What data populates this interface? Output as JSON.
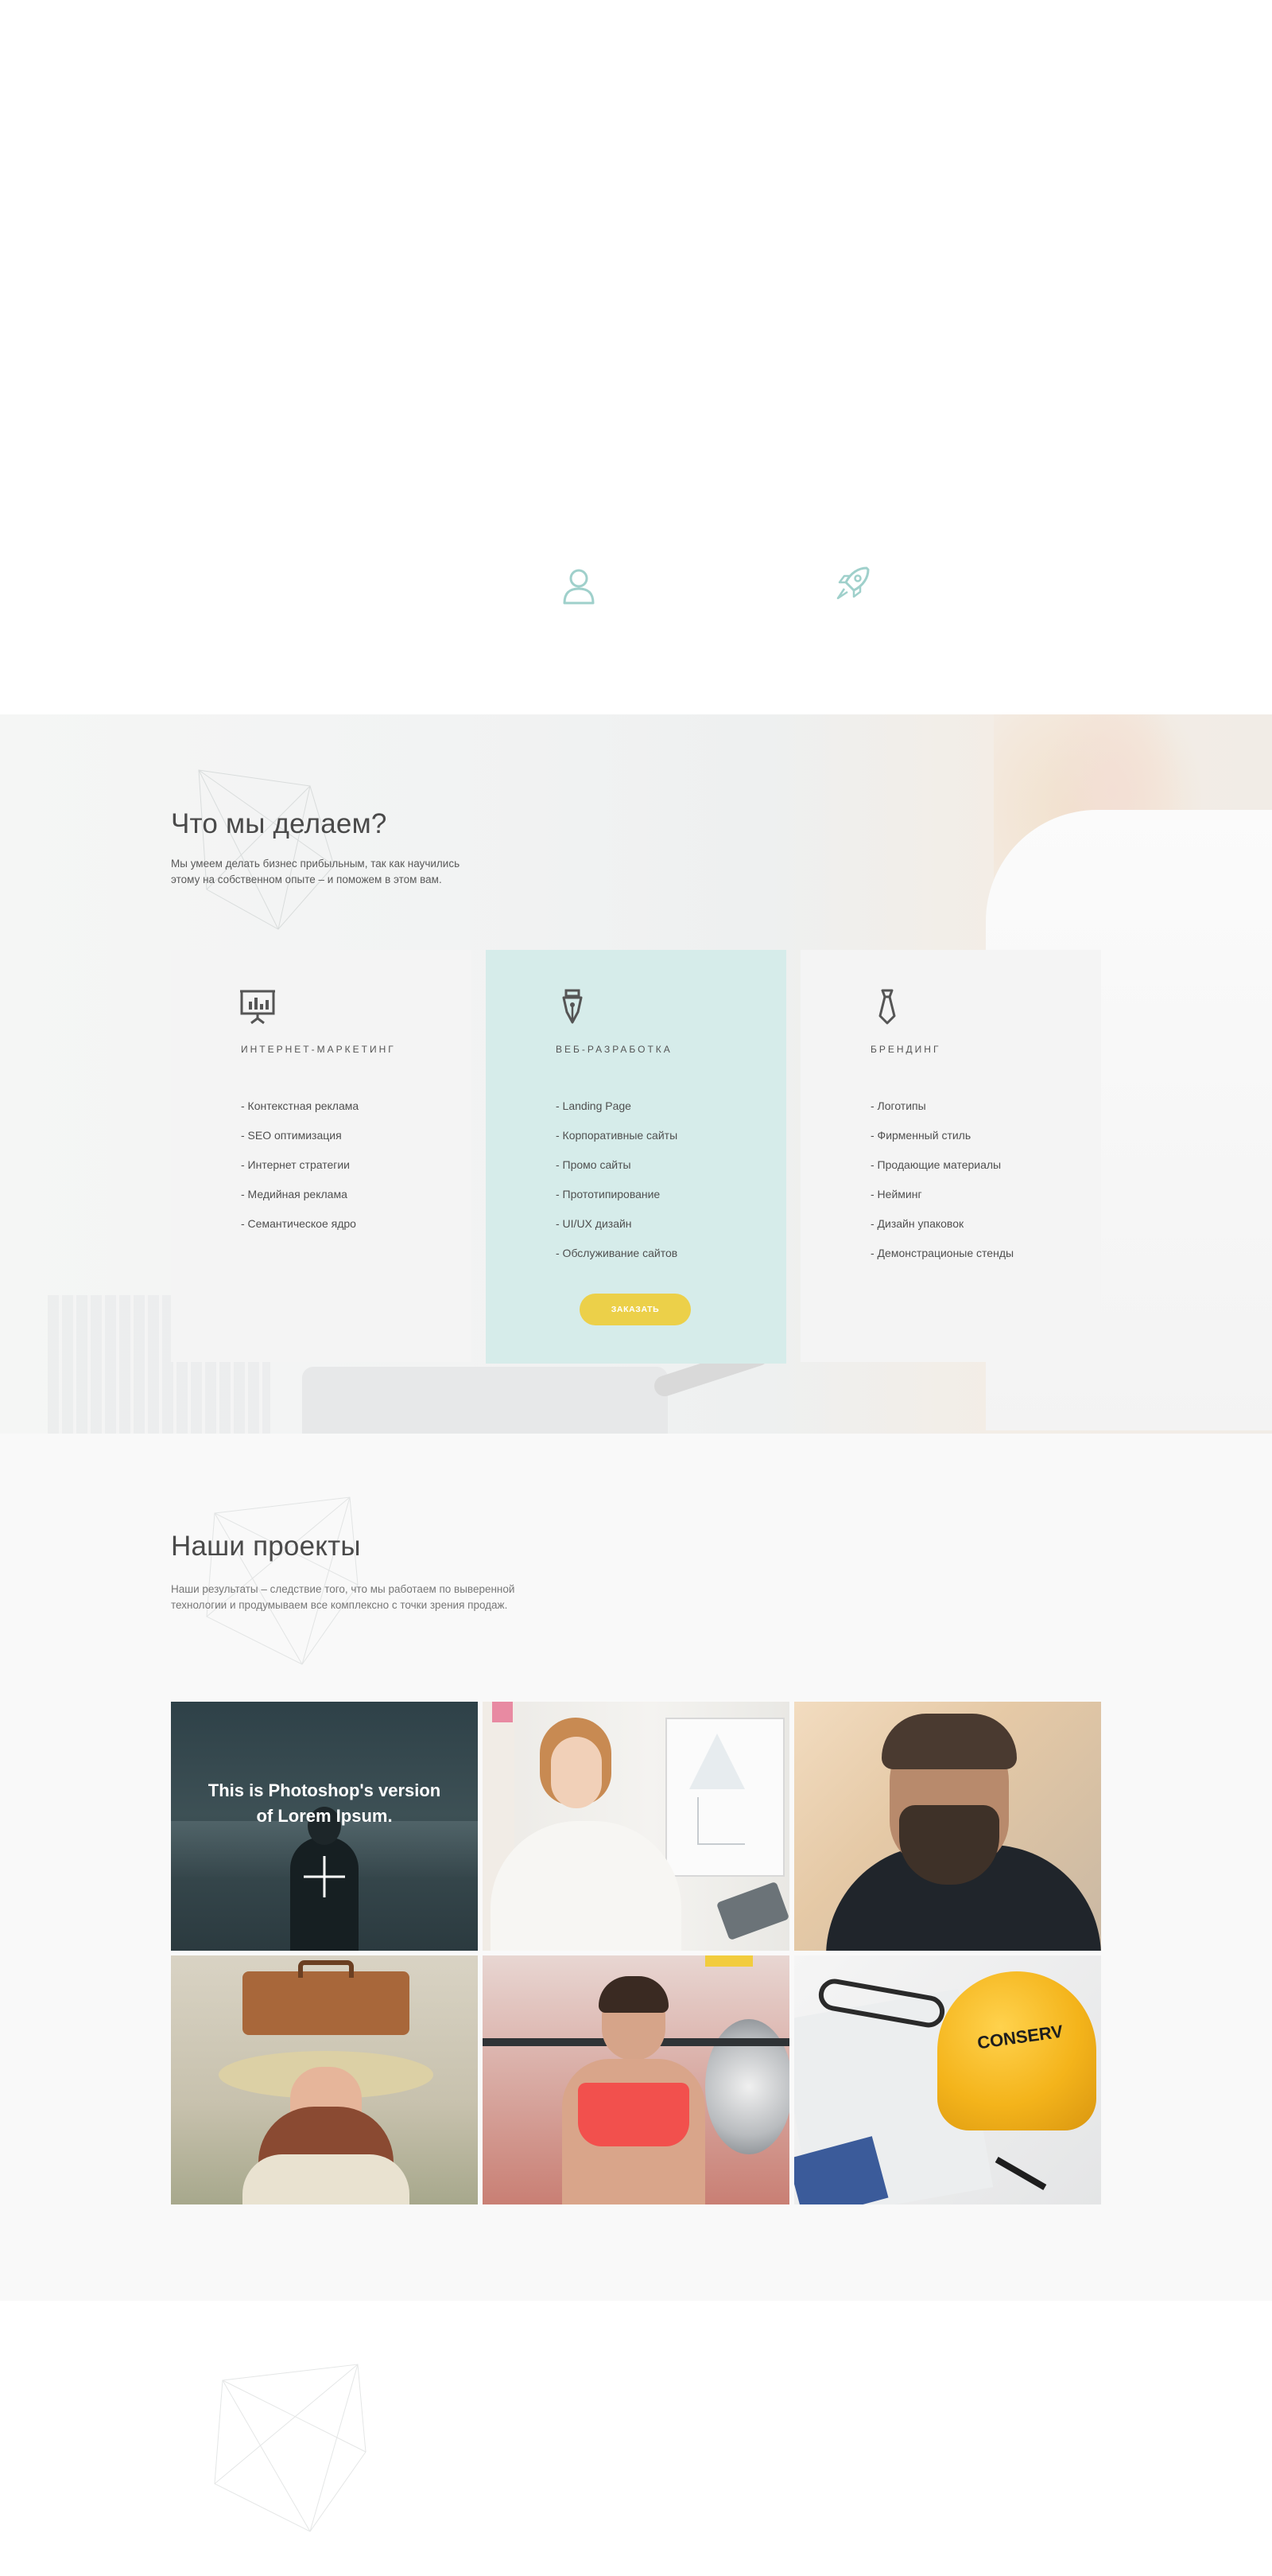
{
  "hero": {
    "icons": [
      "user-icon",
      "rocket-icon"
    ]
  },
  "services": {
    "title": "Что мы делаем?",
    "subtitle_line1": "Мы умеем делать бизнес прибыльным, так как научились",
    "subtitle_line2": "этому на собственном опыте – и поможем в этом вам.",
    "cards": [
      {
        "icon": "presentation-chart-icon",
        "title": "ИНТЕРНЕТ-МАРКЕТИНГ",
        "items": [
          "- Контекстная реклама",
          "- SEO оптимизация",
          "- Интернет стратегии",
          "- Медийная реклама",
          "- Семантическое ядро"
        ]
      },
      {
        "icon": "pen-nib-icon",
        "title": "ВЕБ-РАЗРАБОТКА",
        "items": [
          "- Landing Page",
          "- Корпоративные сайты",
          "- Промо сайты",
          "- Прототипирование",
          "- UI/UX дизайн",
          "- Обслуживание сайтов"
        ],
        "button": "ЗАКАЗАТЬ"
      },
      {
        "icon": "necktie-icon",
        "title": "БРЕНДИНГ",
        "items": [
          "- Логотипы",
          "- Фирменный стиль",
          "- Продающие материалы",
          "- Нейминг",
          "- Дизайн упаковок",
          "- Демонстрационые стенды"
        ]
      }
    ],
    "colors": {
      "active_card": "#d6ecea",
      "button": "#ecd049",
      "card": "#f4f4f4"
    }
  },
  "projects": {
    "title": "Наши проекты",
    "subtitle_line1": "Наши результаты – следствие того, что мы работаем по выверенной",
    "subtitle_line2": "технологии и продумываем все комплексно с точки зрения продаж.",
    "featured": {
      "line1": "This is Photoshop's version",
      "line2": "of Lorem Ipsum."
    },
    "helmet_text": "CONSERV",
    "tiles": [
      "featured-project",
      "businesswoman-whiteboard",
      "bearded-man",
      "woman-suitcase",
      "woman-barbell",
      "construction-helmet"
    ]
  }
}
